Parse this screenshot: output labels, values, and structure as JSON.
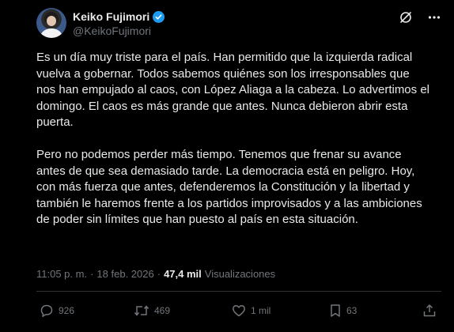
{
  "user": {
    "display_name": "Keiko Fujimori",
    "handle": "@KeikoFujimori"
  },
  "tweet": {
    "text": "Es un día muy triste para el país. Han permitido que la izquierda radical vuelva a gobernar. Todos sabemos quiénes son los irresponsables que nos han empujado al caos, con López Aliaga a la cabeza. Lo advertimos el domingo. El caos es más grande que antes. Nunca debieron abrir esta puerta.\n\nPero no podemos perder más tiempo. Tenemos que frenar su avance antes de que sea demasiado tarde. La democracia está en peligro. Hoy, con más fuerza que antes, defenderemos la Constitución y la libertad y también le haremos frente a los partidos improvisados y a las ambiciones de poder sin límites que han puesto al país en esta situación.",
    "time": "11:05 p. m.",
    "sep": "·",
    "date": "18 feb. 2026",
    "views_count": "47,4 mil",
    "views_label": "Visualizaciones"
  },
  "actions": {
    "replies": "926",
    "reposts": "469",
    "likes": "1 mil",
    "bookmarks": "63"
  },
  "colors": {
    "background": "#000000",
    "text": "#e7e9ea",
    "secondary": "#71767b",
    "verified": "#1d9bf0"
  },
  "icons": [
    "verified-badge-icon",
    "grok-icon",
    "more-icon",
    "reply-icon",
    "repost-icon",
    "like-icon",
    "bookmark-icon",
    "share-icon"
  ]
}
